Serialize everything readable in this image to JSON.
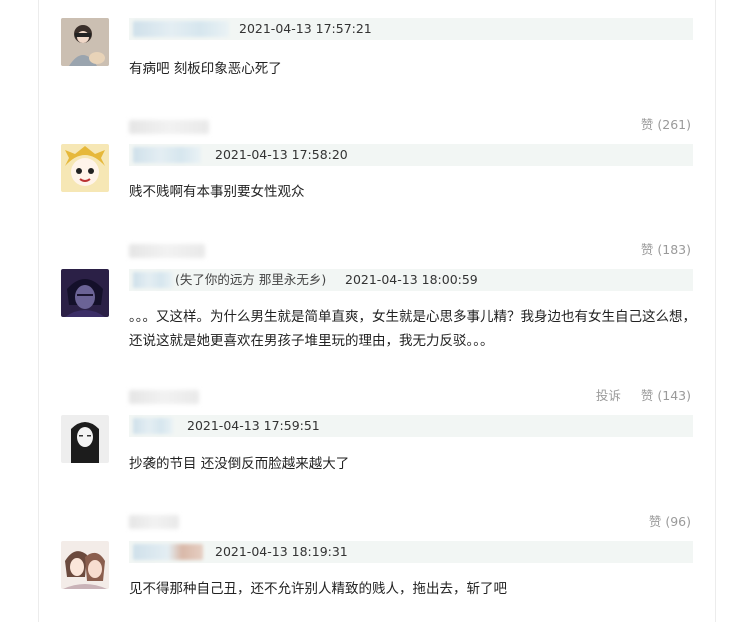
{
  "comments": [
    {
      "time": "2021-04-13 17:57:21",
      "extra": "",
      "text": "有病吧 刻板印象恶心死了",
      "like_label": "赞 (261)",
      "report_label": ""
    },
    {
      "time": "2021-04-13 17:58:20",
      "extra": "",
      "text": "贱不贱啊有本事别要女性观众",
      "like_label": "赞 (183)",
      "report_label": ""
    },
    {
      "time": "2021-04-13 18:00:59",
      "extra": "(失了你的远方 那里永无乡)",
      "text": "。。。又这样。为什么男生就是简单直爽，女生就是心思多事儿精？我身边也有女生自己这么想，还说这就是她更喜欢在男孩子堆里玩的理由，我无力反驳。。。",
      "like_label": "赞 (143)",
      "report_label": "投诉"
    },
    {
      "time": "2021-04-13 17:59:51",
      "extra": "",
      "text": "抄袭的节目 还没倒反而脸越来越大了",
      "like_label": "赞 (96)",
      "report_label": ""
    },
    {
      "time": "2021-04-13 18:19:31",
      "extra": "",
      "text": "见不得那种自己丑，还不允许别人精致的贱人，拖出去，斩了吧",
      "like_label": "",
      "report_label": ""
    }
  ]
}
